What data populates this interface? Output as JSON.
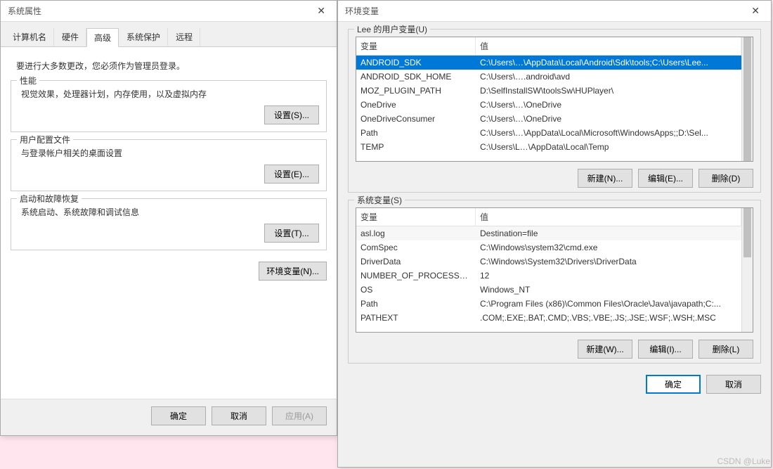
{
  "sysprop": {
    "title": "系统属性",
    "tabs": {
      "computer_name": "计算机名",
      "hardware": "硬件",
      "advanced": "高级",
      "protection": "系统保护",
      "remote": "远程"
    },
    "intro": "要进行大多数更改，您必须作为管理员登录。",
    "perf": {
      "legend": "性能",
      "desc": "视觉效果，处理器计划，内存使用，以及虚拟内存",
      "settings_btn": "设置(S)..."
    },
    "profiles": {
      "legend": "用户配置文件",
      "desc": "与登录帐户相关的桌面设置",
      "settings_btn": "设置(E)..."
    },
    "startup": {
      "legend": "启动和故障恢复",
      "desc": "系统启动、系统故障和调试信息",
      "settings_btn": "设置(T)..."
    },
    "envvars_btn": "环境变量(N)...",
    "ok": "确定",
    "cancel": "取消",
    "apply": "应用(A)"
  },
  "env": {
    "title": "环境变量",
    "user_legend": "Lee 的用户变量(U)",
    "col_var": "变量",
    "col_val": "值",
    "user_vars": [
      {
        "name": "ANDROID_SDK",
        "value": "C:\\Users\\…\\AppData\\Local\\Android\\Sdk\\tools;C:\\Users\\Lee..."
      },
      {
        "name": "ANDROID_SDK_HOME",
        "value": "C:\\Users\\….android\\avd"
      },
      {
        "name": "MOZ_PLUGIN_PATH",
        "value": "D:\\SelfInstallSW\\toolsSw\\HUPlayer\\"
      },
      {
        "name": "OneDrive",
        "value": "C:\\Users\\…\\OneDrive"
      },
      {
        "name": "OneDriveConsumer",
        "value": "C:\\Users\\…\\OneDrive"
      },
      {
        "name": "Path",
        "value": "C:\\Users\\…\\AppData\\Local\\Microsoft\\WindowsApps;;D:\\Sel..."
      },
      {
        "name": "TEMP",
        "value": "C:\\Users\\L…\\AppData\\Local\\Temp"
      }
    ],
    "user_new": "新建(N)...",
    "user_edit": "编辑(E)...",
    "user_delete": "删除(D)",
    "sys_legend": "系统变量(S)",
    "sys_vars": [
      {
        "name": "asl.log",
        "value": "Destination=file"
      },
      {
        "name": "ComSpec",
        "value": "C:\\Windows\\system32\\cmd.exe"
      },
      {
        "name": "DriverData",
        "value": "C:\\Windows\\System32\\Drivers\\DriverData"
      },
      {
        "name": "NUMBER_OF_PROCESSORS",
        "value": "12"
      },
      {
        "name": "OS",
        "value": "Windows_NT"
      },
      {
        "name": "Path",
        "value": "C:\\Program Files (x86)\\Common Files\\Oracle\\Java\\javapath;C:..."
      },
      {
        "name": "PATHEXT",
        "value": ".COM;.EXE;.BAT;.CMD;.VBS;.VBE;.JS;.JSE;.WSF;.WSH;.MSC"
      }
    ],
    "sys_new": "新建(W)...",
    "sys_edit": "编辑(I)...",
    "sys_delete": "删除(L)",
    "ok": "确定",
    "cancel": "取消"
  },
  "watermark": "CSDN @Luke"
}
